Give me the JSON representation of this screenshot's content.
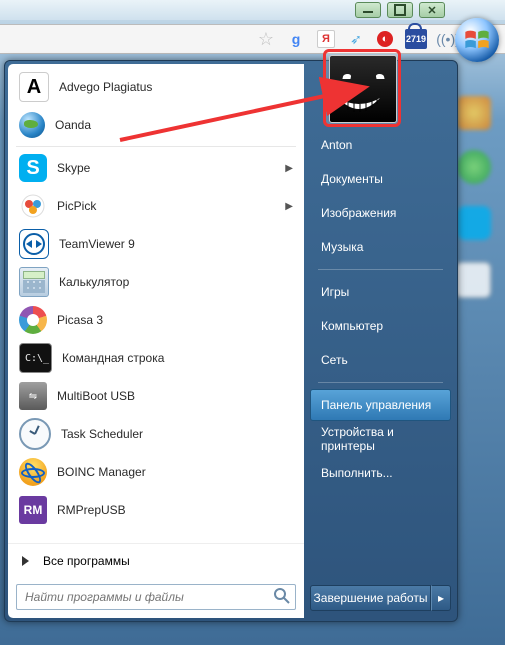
{
  "toolbar": {
    "counter": "2719"
  },
  "left_panel": {
    "items": [
      {
        "label": "Advego Plagiatus",
        "has_submenu": false
      },
      {
        "label": "Oanda",
        "has_submenu": false
      },
      {
        "label": "Skype",
        "has_submenu": true
      },
      {
        "label": "PicPick",
        "has_submenu": true
      },
      {
        "label": "TeamViewer 9",
        "has_submenu": false
      },
      {
        "label": "Калькулятор",
        "has_submenu": false
      },
      {
        "label": "Picasa 3",
        "has_submenu": false
      },
      {
        "label": "Командная строка",
        "has_submenu": false
      },
      {
        "label": "MultiBoot USB",
        "has_submenu": false
      },
      {
        "label": "Task Scheduler",
        "has_submenu": false
      },
      {
        "label": "BOINC Manager",
        "has_submenu": false
      },
      {
        "label": "RMPrepUSB",
        "has_submenu": false
      }
    ],
    "all_programs": "Все программы",
    "search_placeholder": "Найти программы и файлы"
  },
  "right_panel": {
    "user": "Anton",
    "links": {
      "documents": "Документы",
      "pictures": "Изображения",
      "music": "Музыка",
      "games": "Игры",
      "computer": "Компьютер",
      "network": "Сеть",
      "control": "Панель управления",
      "devices": "Устройства и принтеры",
      "run": "Выполнить..."
    },
    "shutdown": "Завершение работы"
  }
}
